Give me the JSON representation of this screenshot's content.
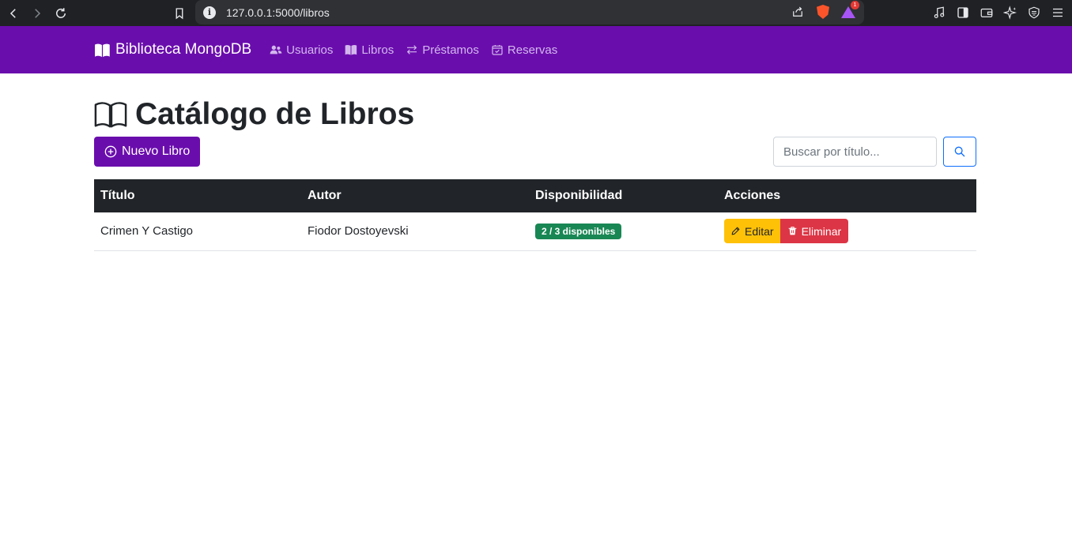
{
  "browser": {
    "url": "127.0.0.1:5000/libros",
    "info_glyph": "i",
    "rewards_badge": "1"
  },
  "navbar": {
    "brand": "Biblioteca MongoDB",
    "links": [
      {
        "label": "Usuarios",
        "icon": "users-icon"
      },
      {
        "label": "Libros",
        "icon": "book-icon"
      },
      {
        "label": "Préstamos",
        "icon": "arrows-exchange-icon"
      },
      {
        "label": "Reservas",
        "icon": "calendar-check-icon"
      }
    ],
    "background_color": "#6a0dad",
    "link_color": "#d2b7ec"
  },
  "page": {
    "title": "Catálogo de Libros",
    "new_button_label": "Nuevo Libro",
    "search_placeholder": "Buscar por título..."
  },
  "table": {
    "headers": [
      "Título",
      "Autor",
      "Disponibilidad",
      "Acciones"
    ],
    "rows": [
      {
        "titulo": "Crimen Y Castigo",
        "autor": "Fiodor Dostoyevski",
        "disponibilidad": "2 / 3 disponibles",
        "edit_label": "Editar",
        "delete_label": "Eliminar"
      }
    ]
  },
  "colors": {
    "primary": "#6a0dad",
    "table_header": "#212529",
    "badge_success": "#198754",
    "warning": "#ffc107",
    "danger": "#dc3545",
    "search_border": "#0d6efd"
  }
}
